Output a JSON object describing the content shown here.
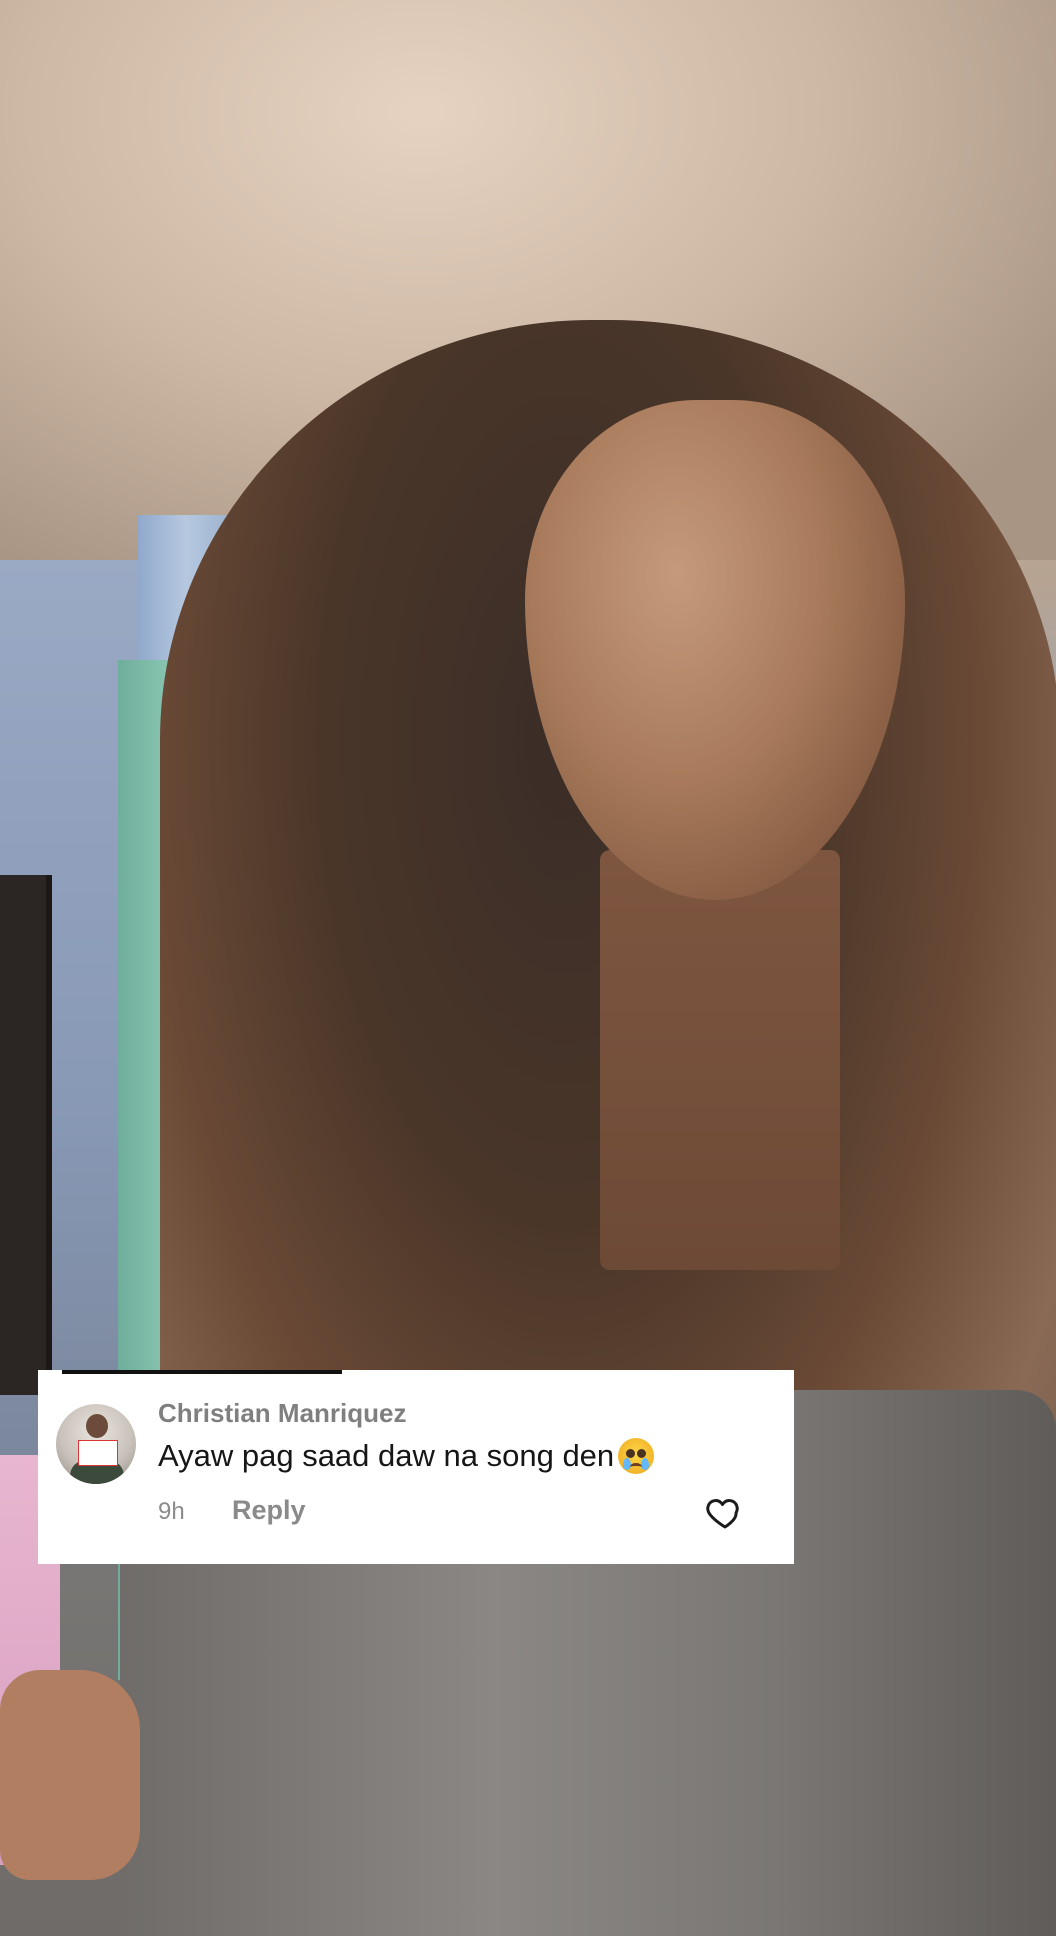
{
  "comment": {
    "username": "Christian Manriquez",
    "text": "Ayaw pag saad daw na song den",
    "emoji_name": "face-holding-back-tears-icon",
    "time": "9h",
    "reply_label": "Reply"
  },
  "colors": {
    "card_background": "#ffffff",
    "username": "#7f7f7f",
    "comment_text": "#161616",
    "meta_text": "#8c8c8c"
  }
}
